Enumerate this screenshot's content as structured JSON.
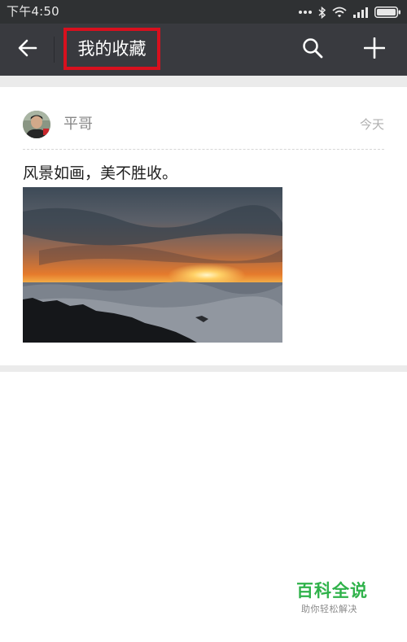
{
  "status_bar": {
    "time": "下午4:50",
    "icons": [
      "dots-icon",
      "bluetooth-icon",
      "wifi-icon",
      "signal-icon",
      "battery-icon"
    ]
  },
  "header": {
    "title": "我的收藏",
    "back_icon": "back-arrow-icon",
    "search_icon": "search-icon",
    "add_icon": "plus-icon",
    "title_highlight_color": "#d8101e",
    "bar_color": "#393a3f"
  },
  "favorites": [
    {
      "author": "平哥",
      "date": "今天",
      "text": "风景如画，美不胜收。",
      "image": "sunset-over-sea-of-clouds"
    }
  ],
  "watermark": {
    "title": "百科全说",
    "subtitle": "助你轻松解决",
    "color": "#2fb24a"
  }
}
